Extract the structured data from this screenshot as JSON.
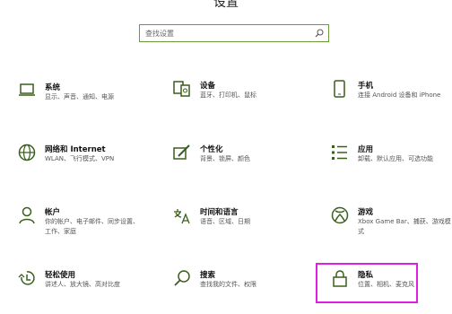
{
  "header": {
    "title": "设置"
  },
  "search": {
    "placeholder": "查找设置"
  },
  "colors": {
    "accent": "#6a9a3a",
    "icon": "#3a5f1c",
    "highlight": "#e020e0"
  },
  "tiles": [
    {
      "name": "系统",
      "desc": "显示、声音、通知、电源",
      "icon": "laptop-icon"
    },
    {
      "name": "设备",
      "desc": "蓝牙、打印机、鼠标",
      "icon": "devices-icon"
    },
    {
      "name": "手机",
      "desc": "连接 Android 设备和 iPhone",
      "icon": "phone-icon"
    },
    {
      "name": "网络和 Internet",
      "desc": "WLAN、飞行模式、VPN",
      "icon": "globe-icon"
    },
    {
      "name": "个性化",
      "desc": "背景、锁屏、颜色",
      "icon": "personalization-icon"
    },
    {
      "name": "应用",
      "desc": "卸载、默认应用、可选功能",
      "icon": "apps-icon"
    },
    {
      "name": "帐户",
      "desc": "你的帐户、电子邮件、同步设置、工作、家庭",
      "icon": "account-icon"
    },
    {
      "name": "时间和语言",
      "desc": "语音、区域、日期",
      "icon": "time-language-icon"
    },
    {
      "name": "游戏",
      "desc": "Xbox Game Bar、捕获、游戏模式",
      "icon": "xbox-icon"
    },
    {
      "name": "轻松使用",
      "desc": "讲述人、放大镜、高对比度",
      "icon": "ease-of-access-icon"
    },
    {
      "name": "搜索",
      "desc": "查找我的文件、权限",
      "icon": "search-icon"
    },
    {
      "name": "隐私",
      "desc": "位置、相机、麦克风",
      "icon": "lock-icon"
    }
  ]
}
